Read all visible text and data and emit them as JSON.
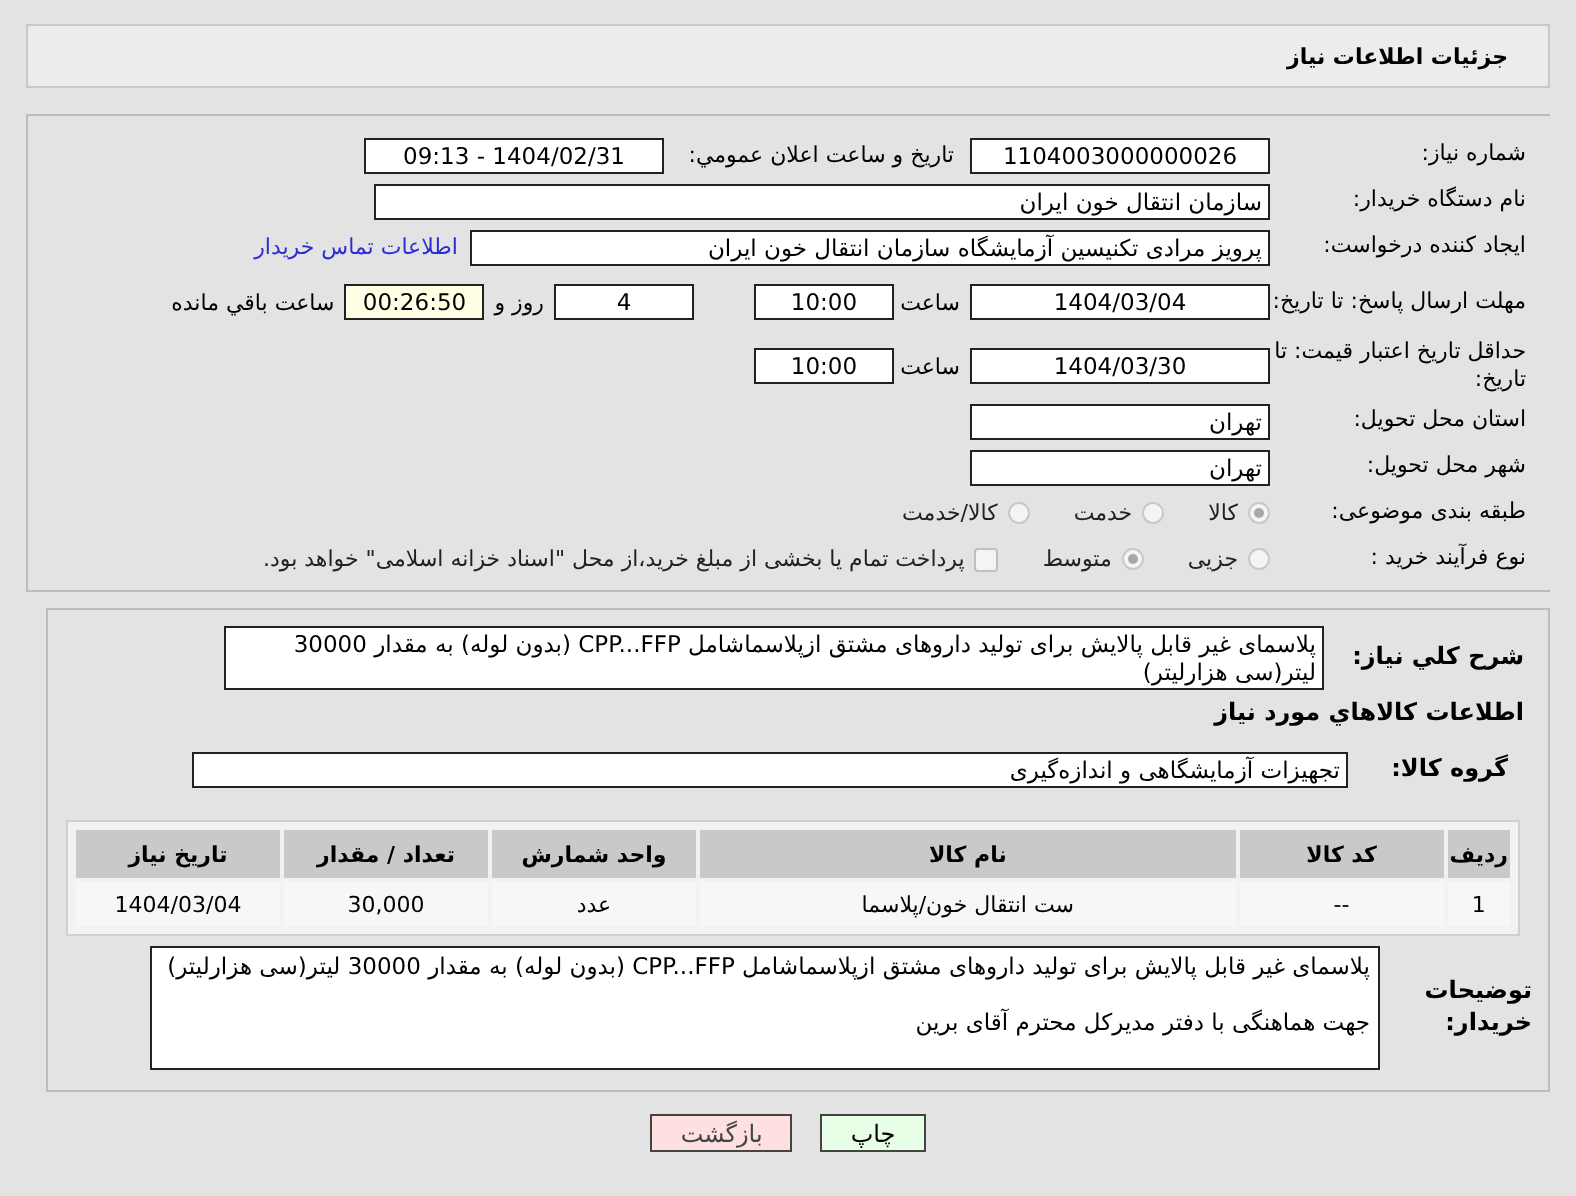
{
  "header": {
    "title": "جزئیات اطلاعات نیاز"
  },
  "form": {
    "need_number": {
      "label": "شماره نیاز:",
      "value": "1104003000000026"
    },
    "announce": {
      "label": "تاریخ و ساعت اعلان عمومي:",
      "value": "1404/02/31 - 09:13"
    },
    "buyer_org": {
      "label": "نام دستگاه خریدار:",
      "value": "سازمان انتقال خون ایران"
    },
    "creator": {
      "label": "ایجاد کننده درخواست:",
      "value": "پرویز مرادی تکنیسین آزمایشگاه سازمان انتقال خون ایران",
      "link": "اطلاعات تماس خریدار"
    },
    "deadline": {
      "label": "مهلت ارسال پاسخ: تا تاریخ:",
      "date": "1404/03/04",
      "time_label": "ساعت",
      "time": "10:00",
      "days": "4",
      "days_label": "روز و",
      "remaining": "00:26:50",
      "remaining_label": "ساعت باقي مانده"
    },
    "validity": {
      "label": "حداقل تاریخ اعتبار قیمت: تا تاریخ:",
      "date": "1404/03/30",
      "time_label": "ساعت",
      "time": "10:00"
    },
    "province": {
      "label": "استان محل تحویل:",
      "value": "تهران"
    },
    "city": {
      "label": "شهر محل تحویل:",
      "value": "تهران"
    },
    "category": {
      "label": "طبقه بندی موضوعی:",
      "options": [
        {
          "label": "کالا",
          "selected": true
        },
        {
          "label": "خدمت",
          "selected": false
        },
        {
          "label": "کالا/خدمت",
          "selected": false
        }
      ]
    },
    "process": {
      "label": "نوع فرآیند خرید :",
      "options": [
        {
          "label": "جزیی",
          "selected": false
        },
        {
          "label": "متوسط",
          "selected": true
        }
      ],
      "payment": {
        "label": "پرداخت تمام یا بخشی از مبلغ خرید،از محل \"اسناد خزانه اسلامی\" خواهد بود.",
        "checked": false
      }
    }
  },
  "details": {
    "description": {
      "label": "شرح كلي نياز:",
      "value": "پلاسمای غیر قابل پالایش برای تولید داروهای مشتق ازپلاسماشامل CPP...FFP (بدون لوله) به مقدار 30000 لیتر(سی هزارلیتر)"
    },
    "goods_heading": "اطلاعات كالاهاي مورد نياز",
    "group": {
      "label": "گروه کالا:",
      "value": "تجهیزات آزمایشگاهی و اندازه‌گیری"
    },
    "table": {
      "columns": [
        "ردیف",
        "کد کالا",
        "نام کالا",
        "واحد شمارش",
        "تعداد / مقدار",
        "تاریخ نیاز"
      ],
      "rows": [
        [
          "1",
          "--",
          "ست انتقال خون/پلاسما",
          "عدد",
          "30,000",
          "1404/03/04"
        ]
      ]
    },
    "notes": {
      "label": "توضیحات خریدار:",
      "paragraphs": [
        "پلاسمای غیر قابل پالایش برای تولید داروهای مشتق ازپلاسماشامل CPP...FFP (بدون لوله) به مقدار 30000 لیتر(سی هزارلیتر)",
        "جهت هماهنگی با دفتر مدیرکل محترم آقای برین"
      ]
    }
  },
  "buttons": [
    {
      "label": "چاپ",
      "kind": "print"
    },
    {
      "label": "بازگشت",
      "kind": "back"
    }
  ]
}
